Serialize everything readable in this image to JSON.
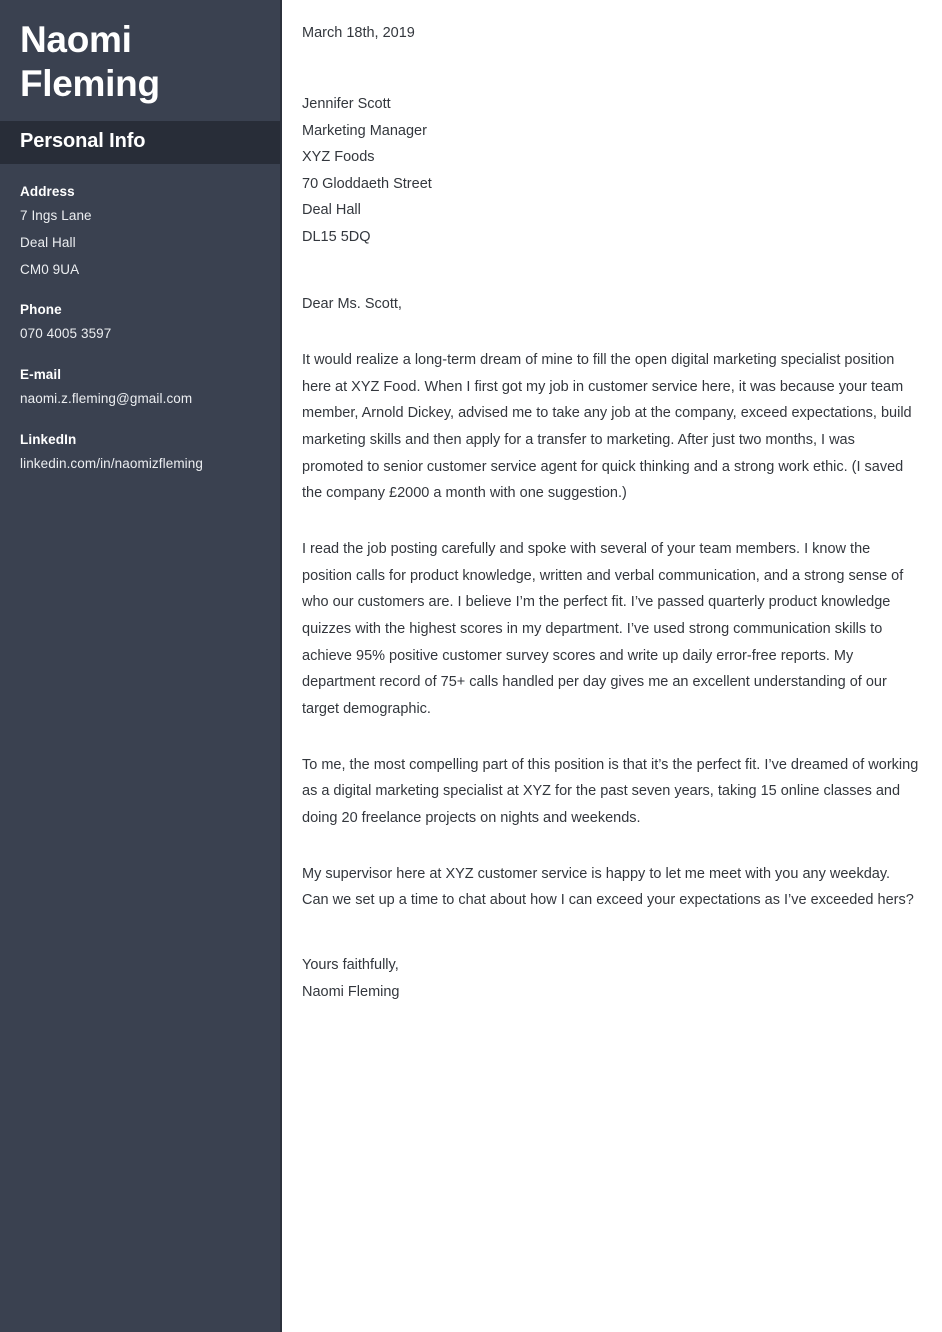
{
  "sidebar": {
    "name_lines": [
      "Naomi",
      "Fleming"
    ],
    "section_title": "Personal Info",
    "details": [
      {
        "label": "Address",
        "values": [
          "7 Ings Lane",
          "Deal Hall",
          "CM0 9UA"
        ]
      },
      {
        "label": "Phone",
        "values": [
          "070 4005 3597"
        ]
      },
      {
        "label": "E-mail",
        "values": [
          "naomi.z.fleming@gmail.com"
        ]
      },
      {
        "label": "LinkedIn",
        "values": [
          "linkedin.com/in/naomizfleming"
        ]
      }
    ]
  },
  "letter": {
    "date": "March 18th, 2019",
    "recipient": [
      "Jennifer Scott",
      "Marketing Manager",
      "XYZ Foods",
      "70 Gloddaeth Street",
      "Deal Hall",
      "DL15 5DQ"
    ],
    "salutation": "Dear Ms. Scott,",
    "paragraphs": [
      "It would realize a long-term dream of mine to fill the open digital marketing specialist position here at XYZ Food. When I first got my job in customer service here, it was because your team member, Arnold Dickey, advised me to take any job at the company, exceed expectations, build marketing skills and then apply for a transfer to marketing. After just two months, I was promoted to senior customer service agent for quick thinking and a strong work ethic. (I saved the company £2000 a month with one suggestion.)",
      "I read the job posting carefully and spoke with several of your team members. I know the position calls for product knowledge, written and verbal communication, and a strong sense of who our customers are. I believe I’m the perfect fit. I’ve passed quarterly product knowledge quizzes with the highest scores in my department. I’ve used strong communication skills to achieve 95% positive customer survey scores and write up daily error-free reports. My department record of 75+ calls handled per day gives me an excellent understanding of our target demographic.",
      "To me, the most compelling part of this position is that it’s the perfect fit. I’ve dreamed of working as a digital marketing specialist at XYZ for the past seven years, taking 15 online classes and doing 20 freelance projects on nights and weekends.",
      "My supervisor here at XYZ customer service is happy to let me meet with you any weekday. Can we set up a time to chat about how I can exceed your expectations as I’ve exceeded hers?"
    ],
    "closing": [
      "Yours faithfully,",
      "Naomi Fleming"
    ]
  },
  "colors": {
    "sidebar_bg": "#3a4150",
    "sidebar_band_bg": "#282d38",
    "sidebar_edge": "#2c313c",
    "body_text": "#33373d",
    "page_bg": "#ffffff"
  }
}
